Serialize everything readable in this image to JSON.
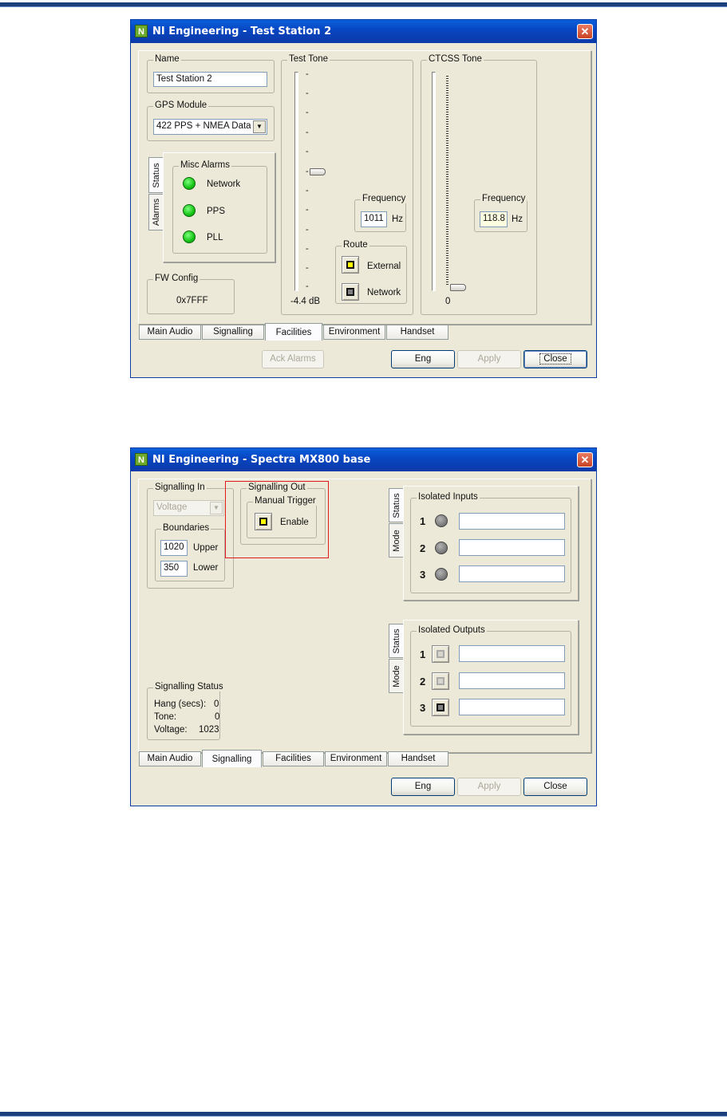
{
  "dialog1": {
    "title": "NI Engineering - Test Station 2",
    "close_icon_label": "✕",
    "name_group": {
      "title": "Name",
      "value": "Test Station 2"
    },
    "gps_group": {
      "title": "GPS Module",
      "value": "422 PPS + NMEA Data"
    },
    "side_tabs": [
      "Status",
      "Alarms"
    ],
    "misc_alarms": {
      "title": "Misc Alarms",
      "items": [
        {
          "label": "Network",
          "state": "green"
        },
        {
          "label": "PPS",
          "state": "green"
        },
        {
          "label": "PLL",
          "state": "green"
        }
      ]
    },
    "fw_config": {
      "title": "FW Config",
      "value": "0x7FFF"
    },
    "test_tone": {
      "title": "Test Tone",
      "level_label": "-4.4 dB",
      "frequency": {
        "title": "Frequency",
        "value": "1011",
        "unit": "Hz"
      },
      "route": {
        "title": "Route",
        "external_label": "External",
        "network_label": "Network"
      }
    },
    "ctcss": {
      "title": "CTCSS Tone",
      "level_label": "0",
      "frequency": {
        "title": "Frequency",
        "value": "118.8",
        "unit": "Hz"
      }
    },
    "tabs": [
      "Main Audio",
      "Signalling",
      "Facilities",
      "Environment",
      "Handset"
    ],
    "selected_tab": "Facilities",
    "buttons": {
      "ack": "Ack Alarms",
      "eng": "Eng",
      "apply": "Apply",
      "close": "Close"
    }
  },
  "dialog2": {
    "title": "NI Engineering - Spectra MX800 base",
    "close_icon_label": "✕",
    "signalling_in": {
      "title": "Signalling In",
      "select_value": "Voltage",
      "boundaries": {
        "title": "Boundaries",
        "upper_value": "1020",
        "upper_label": "Upper",
        "lower_value": "350",
        "lower_label": "Lower"
      }
    },
    "signalling_out": {
      "title": "Signalling Out",
      "manual_trigger": {
        "title": "Manual Trigger",
        "enable_label": "Enable"
      }
    },
    "isolated_inputs": {
      "title": "Isolated Inputs",
      "side_tabs": [
        "Status",
        "Mode"
      ],
      "rows": [
        {
          "num": "1",
          "value": ""
        },
        {
          "num": "2",
          "value": ""
        },
        {
          "num": "3",
          "value": ""
        }
      ]
    },
    "isolated_outputs": {
      "title": "Isolated Outputs",
      "side_tabs": [
        "Status",
        "Mode"
      ],
      "rows": [
        {
          "num": "1",
          "value": ""
        },
        {
          "num": "2",
          "value": ""
        },
        {
          "num": "3",
          "value": ""
        }
      ]
    },
    "signalling_status": {
      "title": "Signalling Status",
      "hang_label": "Hang (secs):",
      "hang_value": "0",
      "tone_label": "Tone:",
      "tone_value": "0",
      "voltage_label": "Voltage:",
      "voltage_value": "1023"
    },
    "tabs": [
      "Main Audio",
      "Signalling",
      "Facilities",
      "Environment",
      "Handset"
    ],
    "selected_tab": "Signalling",
    "buttons": {
      "eng": "Eng",
      "apply": "Apply",
      "close": "Close"
    }
  },
  "colors": {
    "xp_title_blue": "#0a5fdb",
    "led_green": "#16c416",
    "highlight_red": "#e2191b",
    "doc_rule_navy": "#1a3f7a"
  }
}
